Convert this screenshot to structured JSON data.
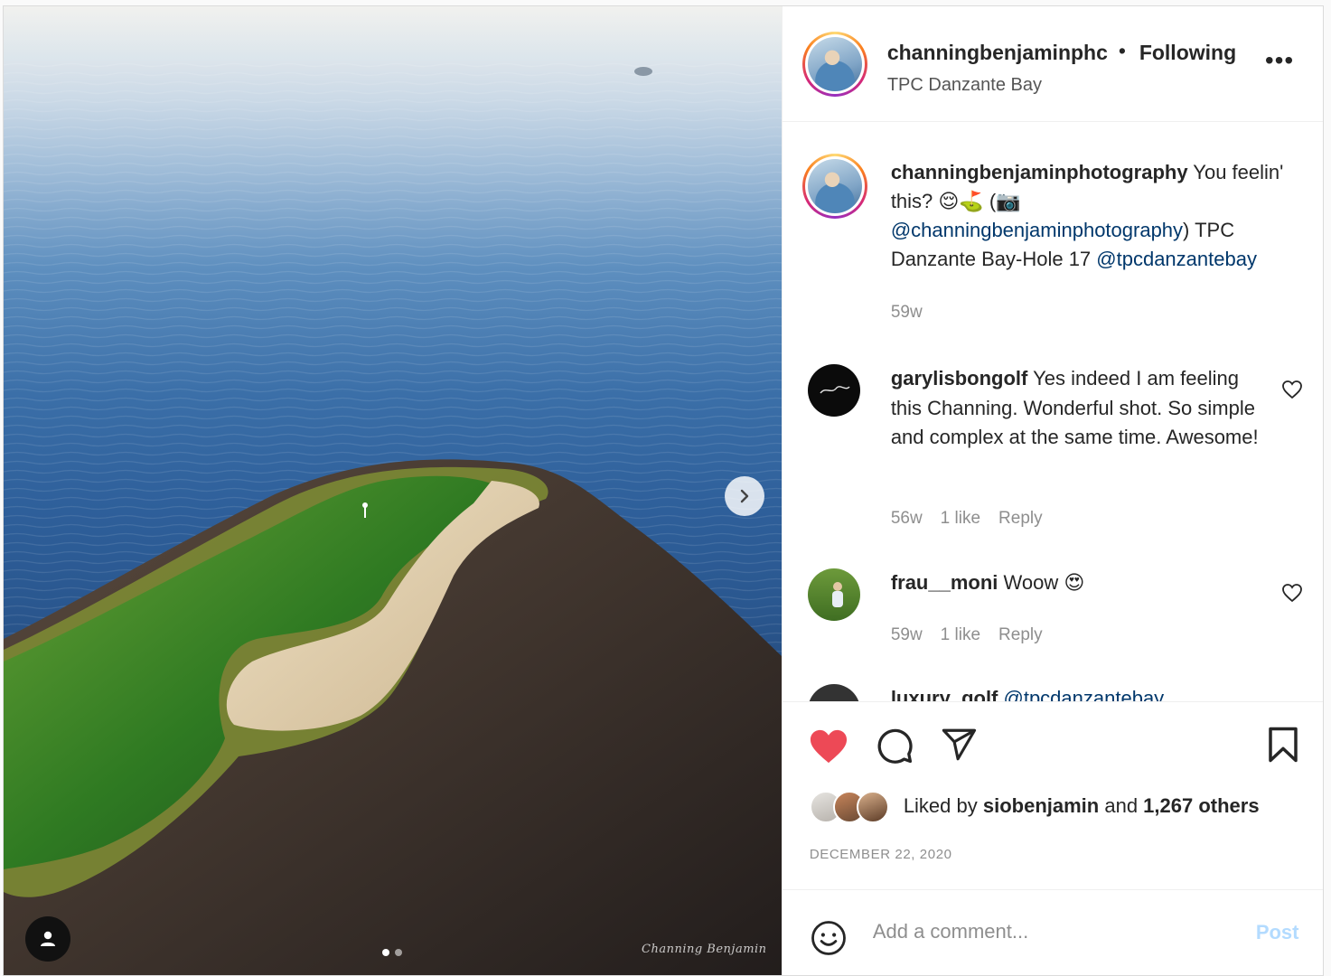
{
  "post": {
    "username": "channingbenjaminphc",
    "follow_separator": "•",
    "follow_status": "Following",
    "location": "TPC Danzante Bay",
    "more_label": "•••",
    "carousel": {
      "slide_count": 2,
      "active_slide": 1
    },
    "watermark": "Channing Benjamin",
    "icons": {
      "next": "chevron-right-icon",
      "tag": "user-tag-icon"
    }
  },
  "caption": {
    "username": "channingbenjaminphotography",
    "text_1": " You feelin' this? 😌⛳ (📷 ",
    "mention_1": "@channingbenjaminphotography",
    "text_2": ") TPC Danzante Bay-Hole 17 ",
    "mention_2": "@tpcdanzantebay",
    "age": "59w"
  },
  "comments": [
    {
      "username": "garylisbongolf",
      "text": " Yes indeed I am feeling this Channing. Wonderful shot. So simple and complex at the same time. Awesome!",
      "age": "56w",
      "likes": "1 like",
      "reply": "Reply"
    },
    {
      "username": "frau__moni",
      "text": " Woow 😍",
      "age": "59w",
      "likes": "1 like",
      "reply": "Reply"
    },
    {
      "username": "luxury_golf",
      "text": " @tpcdanzantebay"
    }
  ],
  "actions": {
    "liked": true,
    "like_color": "#ed4956",
    "likes_prefix": "Liked by ",
    "liked_by": "siobenjamin",
    "likes_mid": " and ",
    "others": "1,267 others",
    "date": "DECEMBER 22, 2020"
  },
  "comment_box": {
    "placeholder": "Add a comment...",
    "post_label": "Post",
    "post_color": "#b3dbff"
  }
}
